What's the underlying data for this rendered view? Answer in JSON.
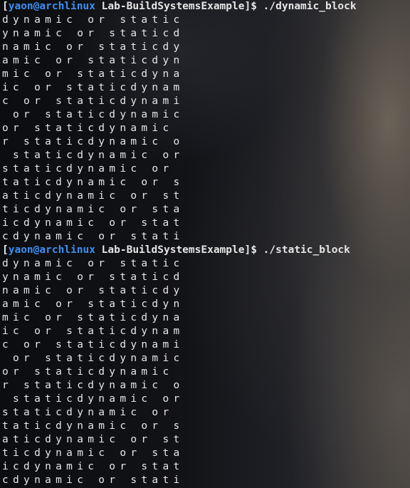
{
  "terminal": {
    "blocks": [
      {
        "prompt": {
          "open_bracket": "[",
          "user_host": "yaon@archlinux",
          "cwd": " Lab-BuildSystemsExample",
          "close_bracket_symbol": "]$ ",
          "command": "./dynamic_block"
        },
        "lines": [
          "dynamic or static",
          "ynamic or staticd",
          "namic or staticdy",
          "amic or staticdyn",
          "mic or staticdyna",
          "ic or staticdynam",
          "c or staticdynami",
          " or staticdynamic",
          "or staticdynamic ",
          "r staticdynamic o",
          " staticdynamic or",
          "staticdynamic or ",
          "taticdynamic or s",
          "aticdynamic or st",
          "ticdynamic or sta",
          "icdynamic or stat",
          "cdynamic or stati"
        ]
      },
      {
        "prompt": {
          "open_bracket": "[",
          "user_host": "yaon@archlinux",
          "cwd": " Lab-BuildSystemsExample",
          "close_bracket_symbol": "]$ ",
          "command": "./static_block"
        },
        "lines": [
          "dynamic or static",
          "ynamic or staticd",
          "namic or staticdy",
          "amic or staticdyn",
          "mic or staticdyna",
          "ic or staticdynam",
          "c or staticdynami",
          " or staticdynamic",
          "or staticdynamic ",
          "r staticdynamic o",
          " staticdynamic or",
          "staticdynamic or ",
          "taticdynamic or s",
          "aticdynamic or st",
          "ticdynamic or sta",
          "icdynamic or stat",
          "cdynamic or stati"
        ]
      }
    ],
    "colors": {
      "prompt_user_host": "#3d8ff2",
      "foreground": "#e6e6e6",
      "background": "#0b0c0f"
    }
  }
}
